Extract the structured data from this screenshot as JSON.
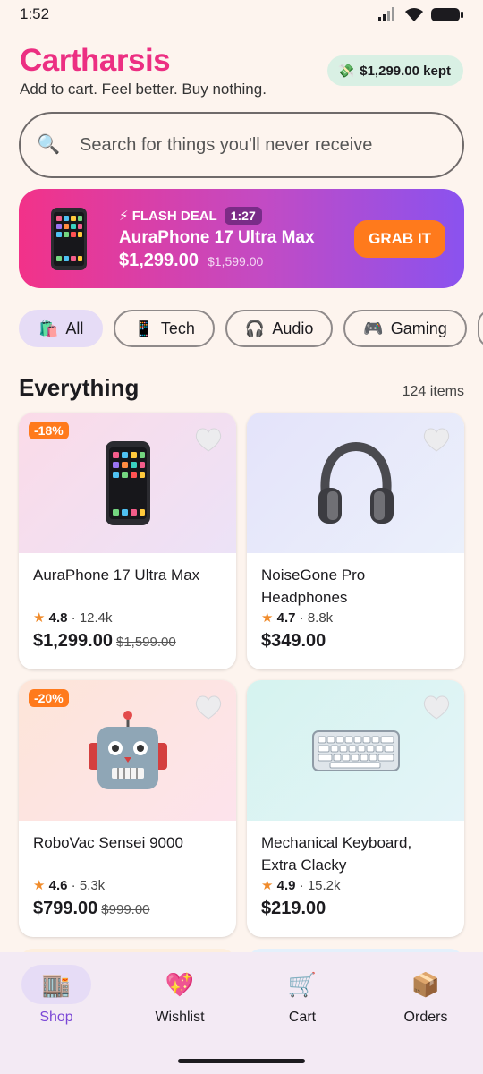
{
  "status": {
    "time": "1:52"
  },
  "header": {
    "brand": "Cartharsis",
    "tagline": "Add to cart. Feel better. Buy nothing.",
    "kept_icon": "money-with-wings-icon",
    "kept_label": "$1,299.00 kept"
  },
  "search": {
    "placeholder": "Search for things you'll never receive"
  },
  "flash": {
    "label": "⚡ FLASH DEAL",
    "timer": "1:27",
    "title": "AuraPhone 17 Ultra Max",
    "price": "$1,299.00",
    "old_price": "$1,599.00",
    "cta": "GRAB IT"
  },
  "categories": [
    {
      "icon": "🛍️",
      "label": "All",
      "active": true
    },
    {
      "icon": "📱",
      "label": "Tech"
    },
    {
      "icon": "🎧",
      "label": "Audio"
    },
    {
      "icon": "🎮",
      "label": "Gaming"
    }
  ],
  "section": {
    "title": "Everything",
    "count": "124 items"
  },
  "products": [
    {
      "discount": "-18%",
      "title": "AuraPhone 17 Ultra Max",
      "rating": "4.8",
      "reviews": "12.4k",
      "price": "$1,299.00",
      "old_price": "$1,599.00",
      "icon": "phone-icon",
      "bg": "linear-gradient(135deg,#fbdbe8,#ece2f7)"
    },
    {
      "discount": "",
      "title": "NoiseGone Pro Headphones",
      "rating": "4.7",
      "reviews": "8.8k",
      "price": "$349.00",
      "old_price": "",
      "icon": "headphones-icon",
      "bg": "linear-gradient(135deg,#e4e3fa,#ebf0fb)"
    },
    {
      "discount": "-20%",
      "title": "RoboVac Sensei 9000",
      "rating": "4.6",
      "reviews": "5.3k",
      "price": "$799.00",
      "old_price": "$999.00",
      "icon": "robot-icon",
      "bg": "linear-gradient(135deg,#fde5d8,#fde3ec)"
    },
    {
      "discount": "",
      "title": "Mechanical Keyboard, Extra Clacky",
      "rating": "4.9",
      "reviews": "15.2k",
      "price": "$219.00",
      "old_price": "",
      "icon": "keyboard-icon",
      "bg": "linear-gradient(135deg,#d5f3ef,#e4f4f8)"
    }
  ],
  "nav": [
    {
      "icon": "🏬",
      "label": "Shop",
      "active": true
    },
    {
      "icon": "💖",
      "label": "Wishlist"
    },
    {
      "icon": "🛒",
      "label": "Cart"
    },
    {
      "icon": "📦",
      "label": "Orders"
    }
  ],
  "colors": {
    "brand": "#ec2f82",
    "accent": "#ff7a1c",
    "nav_active": "#7a46d6"
  }
}
